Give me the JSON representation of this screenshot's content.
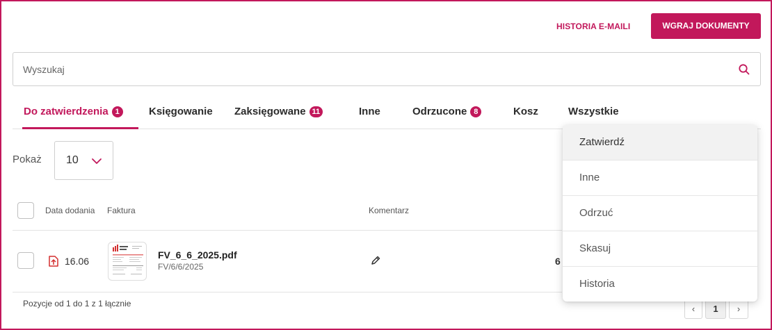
{
  "header": {
    "history_link": "HISTORIA E-MAILI",
    "upload_button": "WGRAJ DOKUMENTY"
  },
  "search": {
    "placeholder": "Wyszukaj",
    "icon": "search-icon"
  },
  "tabs": [
    {
      "label": "Do zatwierdzenia",
      "badge": "1",
      "active": true
    },
    {
      "label": "Księgowanie",
      "badge": null
    },
    {
      "label": "Zaksięgowane",
      "badge": "11"
    },
    {
      "label": "Inne",
      "badge": null
    },
    {
      "label": "Odrzucone",
      "badge": "8"
    },
    {
      "label": "Kosz",
      "badge": null
    },
    {
      "label": "Wszystkie",
      "badge": null
    }
  ],
  "page_size": {
    "label": "Pokaż",
    "value": "10"
  },
  "table": {
    "columns": [
      "Data dodania",
      "Faktura",
      "Komentarz"
    ],
    "rows": [
      {
        "date": "16.06",
        "file_name": "FV_6_6_2025.pdf",
        "invoice_number": "FV/6/6/2025",
        "amount_partial": "6"
      }
    ]
  },
  "footer": {
    "summary": "Pozycje od 1 do 1 z 1 łącznie",
    "prev": "‹",
    "current_page": "1",
    "next": "›"
  },
  "dropdown": {
    "items": [
      "Zatwierdź",
      "Inne",
      "Odrzuć",
      "Skasuj",
      "Historia"
    ]
  },
  "colors": {
    "accent": "#c2185b",
    "border": "#cfcfcf"
  }
}
